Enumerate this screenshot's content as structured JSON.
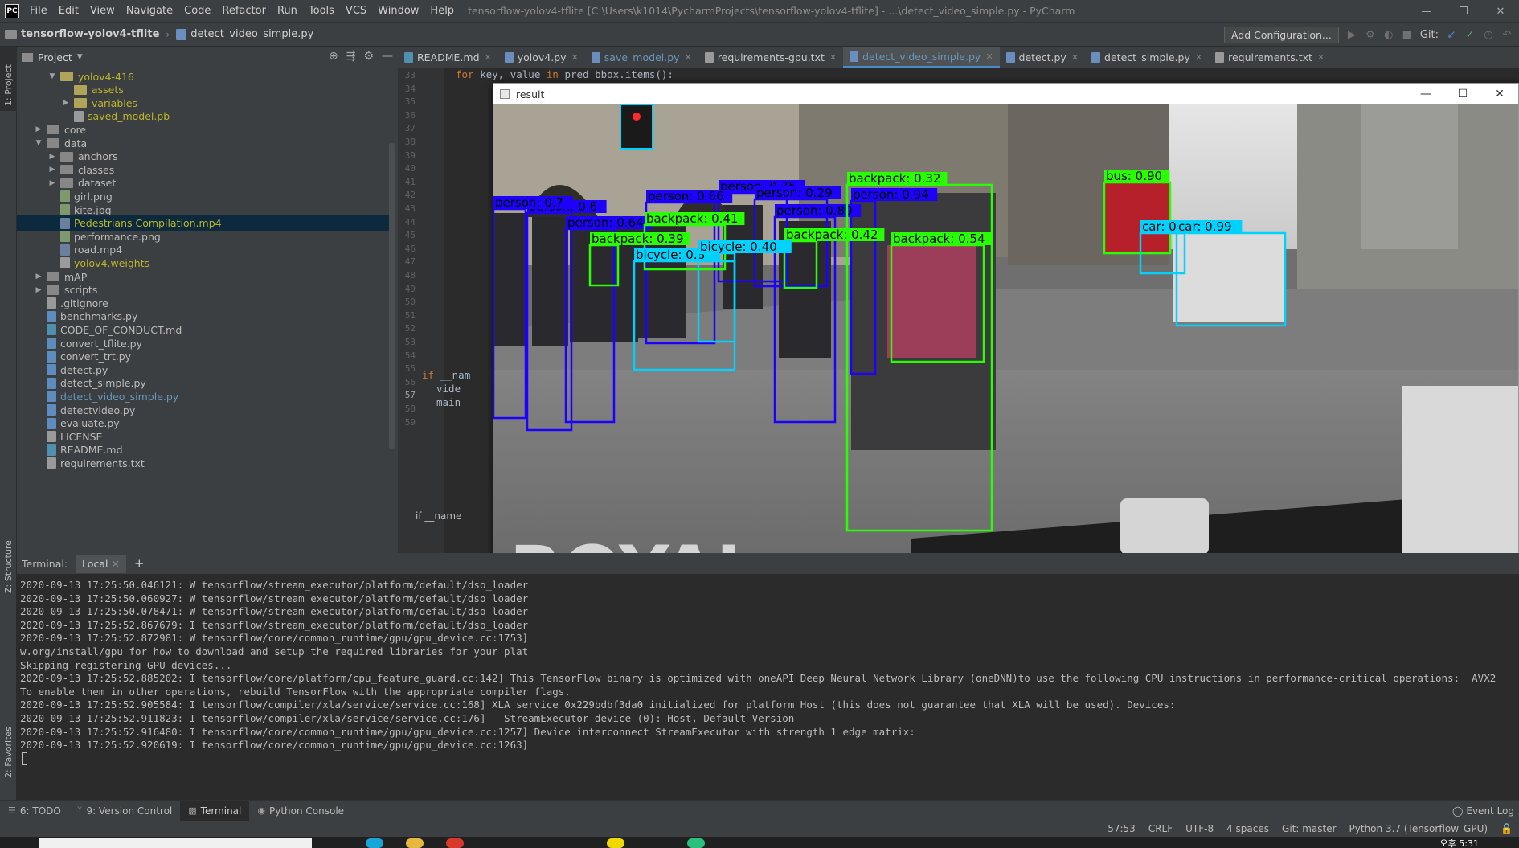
{
  "titlebar": {
    "app_icon": "PC",
    "menus": [
      "File",
      "Edit",
      "View",
      "Navigate",
      "Code",
      "Refactor",
      "Run",
      "Tools",
      "VCS",
      "Window",
      "Help"
    ],
    "window_title": "tensorflow-yolov4-tflite [C:\\Users\\k1014\\PycharmProjects\\tensorflow-yolov4-tflite] - ...\\detect_video_simple.py - PyCharm"
  },
  "navbar": {
    "project": "tensorflow-yolov4-tflite",
    "file": "detect_video_simple.py",
    "add_configuration": "Add Configuration...",
    "git_label": "Git:"
  },
  "leftstrip": {
    "project_label": "1: Project",
    "structure_label": "Z: Structure",
    "favorites_label": "2: Favorites"
  },
  "project_panel": {
    "title": "Project",
    "tree": [
      {
        "label": "yolov4-416",
        "type": "folder",
        "indent": 2,
        "open": true,
        "style": "yellow"
      },
      {
        "label": "assets",
        "type": "folder",
        "indent": 3,
        "open": null,
        "style": "yellow"
      },
      {
        "label": "variables",
        "type": "folder",
        "indent": 3,
        "open": false,
        "style": "yellow"
      },
      {
        "label": "saved_model.pb",
        "type": "file",
        "kind": "txt",
        "indent": 3,
        "style": "yellow"
      },
      {
        "label": "core",
        "type": "folder",
        "indent": 1,
        "open": false,
        "style": ""
      },
      {
        "label": "data",
        "type": "folder",
        "indent": 1,
        "open": true,
        "style": ""
      },
      {
        "label": "anchors",
        "type": "folder",
        "indent": 2,
        "open": false,
        "style": ""
      },
      {
        "label": "classes",
        "type": "folder",
        "indent": 2,
        "open": false,
        "style": ""
      },
      {
        "label": "dataset",
        "type": "folder",
        "indent": 2,
        "open": false,
        "style": ""
      },
      {
        "label": "girl.png",
        "type": "file",
        "kind": "img",
        "indent": 2,
        "style": ""
      },
      {
        "label": "kite.jpg",
        "type": "file",
        "kind": "img",
        "indent": 2,
        "style": ""
      },
      {
        "label": "Pedestrians Compilation.mp4",
        "type": "file",
        "kind": "vid",
        "indent": 2,
        "style": "yellow",
        "selected": true
      },
      {
        "label": "performance.png",
        "type": "file",
        "kind": "img",
        "indent": 2,
        "style": ""
      },
      {
        "label": "road.mp4",
        "type": "file",
        "kind": "vid",
        "indent": 2,
        "style": ""
      },
      {
        "label": "yolov4.weights",
        "type": "file",
        "kind": "txt",
        "indent": 2,
        "style": "yellow"
      },
      {
        "label": "mAP",
        "type": "folder",
        "indent": 1,
        "open": false,
        "style": ""
      },
      {
        "label": "scripts",
        "type": "folder",
        "indent": 1,
        "open": false,
        "style": ""
      },
      {
        "label": ".gitignore",
        "type": "file",
        "kind": "txt",
        "indent": 1,
        "style": ""
      },
      {
        "label": "benchmarks.py",
        "type": "file",
        "kind": "py",
        "indent": 1,
        "style": ""
      },
      {
        "label": "CODE_OF_CONDUCT.md",
        "type": "file",
        "kind": "md",
        "indent": 1,
        "style": ""
      },
      {
        "label": "convert_tflite.py",
        "type": "file",
        "kind": "py",
        "indent": 1,
        "style": ""
      },
      {
        "label": "convert_trt.py",
        "type": "file",
        "kind": "py",
        "indent": 1,
        "style": ""
      },
      {
        "label": "detect.py",
        "type": "file",
        "kind": "py",
        "indent": 1,
        "style": ""
      },
      {
        "label": "detect_simple.py",
        "type": "file",
        "kind": "py",
        "indent": 1,
        "style": ""
      },
      {
        "label": "detect_video_simple.py",
        "type": "file",
        "kind": "py",
        "indent": 1,
        "style": "blue"
      },
      {
        "label": "detectvideo.py",
        "type": "file",
        "kind": "py",
        "indent": 1,
        "style": ""
      },
      {
        "label": "evaluate.py",
        "type": "file",
        "kind": "py",
        "indent": 1,
        "style": ""
      },
      {
        "label": "LICENSE",
        "type": "file",
        "kind": "txt",
        "indent": 1,
        "style": ""
      },
      {
        "label": "README.md",
        "type": "file",
        "kind": "md",
        "indent": 1,
        "style": ""
      },
      {
        "label": "requirements.txt",
        "type": "file",
        "kind": "txt",
        "indent": 1,
        "style": ""
      }
    ]
  },
  "editor": {
    "tabs": [
      {
        "label": "README.md",
        "kind": "md",
        "active": false,
        "closable": true
      },
      {
        "label": "yolov4.py",
        "kind": "py",
        "active": false,
        "closable": true
      },
      {
        "label": "save_model.py",
        "kind": "py",
        "active": false,
        "closable": true,
        "blue": true
      },
      {
        "label": "requirements-gpu.txt",
        "kind": "txt",
        "active": false,
        "closable": true
      },
      {
        "label": "detect_video_simple.py",
        "kind": "py",
        "active": true,
        "closable": true
      },
      {
        "label": "detect.py",
        "kind": "py",
        "active": false,
        "closable": true
      },
      {
        "label": "detect_simple.py",
        "kind": "py",
        "active": false,
        "closable": true
      },
      {
        "label": "requirements.txt",
        "kind": "txt",
        "active": false,
        "closable": true
      }
    ],
    "line_numbers": [
      "33",
      "34",
      "35",
      "36",
      "37",
      "38",
      "39",
      "40",
      "41",
      "42",
      "43",
      "44",
      "45",
      "46",
      "47",
      "48",
      "49",
      "50",
      "51",
      "52",
      "53",
      "54",
      "55",
      "56",
      "57",
      "58",
      "59"
    ],
    "current_line": "57",
    "code_line_33": {
      "kw1": "for",
      "mid": " key, value ",
      "kw2": "in",
      "rest": " pred_bbox.items():"
    },
    "code_line_56": {
      "kw": "if",
      "rest": " __nam"
    },
    "code_line_57": "vide",
    "code_line_58": "main",
    "breadcrumb_bottom": "if __name"
  },
  "result_window": {
    "title": "result",
    "overlay_text": "ROYAL",
    "detections": [
      {
        "label": "person: 0.75",
        "color": "#1e00ff"
      },
      {
        "label": "person: 0.29",
        "color": "#1e00ff"
      },
      {
        "label": "person: 0.94",
        "color": "#1e00ff"
      },
      {
        "label": "person: 0.89",
        "color": "#1e00ff"
      },
      {
        "label": "person: 0.66",
        "color": "#1e00ff"
      },
      {
        "label": "person: 0.6",
        "color": "#1e00ff"
      },
      {
        "label": "person: 0.64",
        "color": "#1e00ff"
      },
      {
        "label": "person: 0.7",
        "color": "#1e00ff"
      },
      {
        "label": "backpack: 0.32",
        "color": "#28ff00"
      },
      {
        "label": "backpack: 0.41",
        "color": "#28ff00"
      },
      {
        "label": "backpack: 0.39",
        "color": "#28ff00"
      },
      {
        "label": "backpack: 0.42",
        "color": "#28ff00"
      },
      {
        "label": "backpack: 0.54",
        "color": "#28ff00"
      },
      {
        "label": "bicycle: 0.8",
        "color": "#00d2ff"
      },
      {
        "label": "bicycle: 0.40",
        "color": "#00d2ff"
      },
      {
        "label": "bus: 0.90",
        "color": "#28ff00"
      },
      {
        "label": "car: 0.95",
        "color": "#00d2ff"
      },
      {
        "label": "car: 0.99",
        "color": "#00d2ff"
      }
    ]
  },
  "terminal": {
    "label": "Terminal:",
    "tab": "Local",
    "lines": [
      "2020-09-13 17:25:50.046121: W tensorflow/stream_executor/platform/default/dso_loader",
      "2020-09-13 17:25:50.060927: W tensorflow/stream_executor/platform/default/dso_loader",
      "2020-09-13 17:25:50.078471: W tensorflow/stream_executor/platform/default/dso_loader",
      "2020-09-13 17:25:52.867679: I tensorflow/stream_executor/platform/default/dso_loader",
      "2020-09-13 17:25:52.872981: W tensorflow/core/common_runtime/gpu/gpu_device.cc:1753]",
      "w.org/install/gpu for how to download and setup the required libraries for your plat",
      "Skipping registering GPU devices...",
      "2020-09-13 17:25:52.885202: I tensorflow/core/platform/cpu_feature_guard.cc:142] This TensorFlow binary is optimized with oneAPI Deep Neural Network Library (oneDNN)to use the following CPU instructions in performance-critical operations:  AVX2",
      "To enable them in other operations, rebuild TensorFlow with the appropriate compiler flags.",
      "2020-09-13 17:25:52.905584: I tensorflow/compiler/xla/service/service.cc:168] XLA service 0x229bdbf3da0 initialized for platform Host (this does not guarantee that XLA will be used). Devices:",
      "2020-09-13 17:25:52.911823: I tensorflow/compiler/xla/service/service.cc:176]   StreamExecutor device (0): Host, Default Version",
      "2020-09-13 17:25:52.916480: I tensorflow/core/common_runtime/gpu/gpu_device.cc:1257] Device interconnect StreamExecutor with strength 1 edge matrix:",
      "2020-09-13 17:25:52.920619: I tensorflow/core/common_runtime/gpu/gpu_device.cc:1263]"
    ]
  },
  "bottom_tools": {
    "todo": "6: TODO",
    "version_control": "9: Version Control",
    "terminal": "Terminal",
    "python_console": "Python Console",
    "event_log": "Event Log"
  },
  "statusbar": {
    "position": "57:53",
    "line_sep": "CRLF",
    "encoding": "UTF-8",
    "indent": "4 spaces",
    "git": "Git: master",
    "interpreter": "Python 3.7 (Tensorflow_GPU)"
  },
  "taskbar": {
    "clock": "오후 5:31"
  }
}
